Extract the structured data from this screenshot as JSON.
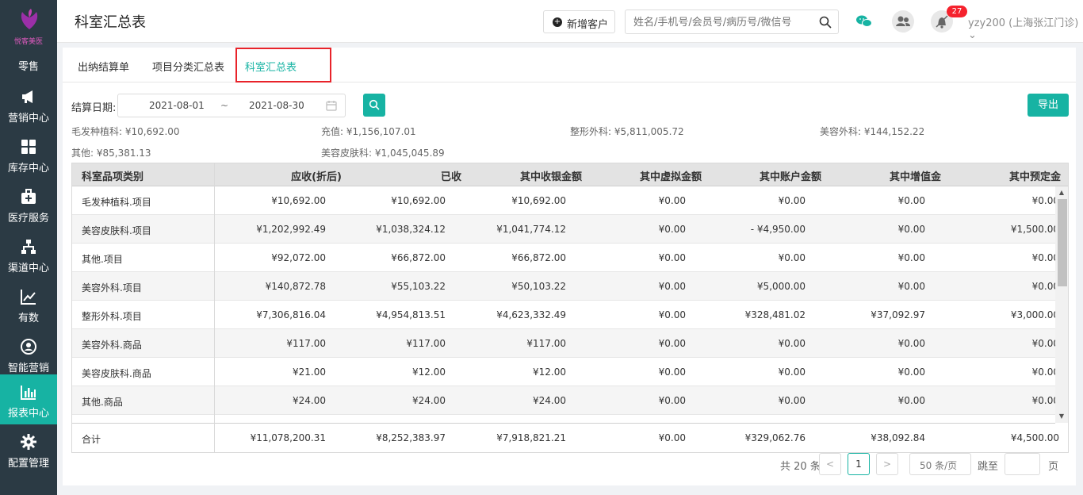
{
  "sidebar": {
    "logo_text": "悦客美医",
    "items": [
      {
        "label": "零售",
        "icon": "retail-icon"
      },
      {
        "label": "营销中心",
        "icon": "megaphone-icon"
      },
      {
        "label": "库存中心",
        "icon": "grid-icon"
      },
      {
        "label": "医疗服务",
        "icon": "medical-kit-icon"
      },
      {
        "label": "渠道中心",
        "icon": "org-chart-icon"
      },
      {
        "label": "有数",
        "icon": "trend-chart-icon"
      },
      {
        "label": "智能营销",
        "icon": "smart-marketing-icon"
      },
      {
        "label": "报表中心",
        "icon": "bar-chart-icon",
        "active": true
      },
      {
        "label": "配置管理",
        "icon": "gear-icon"
      }
    ]
  },
  "header": {
    "title": "科室汇总表",
    "new_customer": "新增客户",
    "search_placeholder": "姓名/手机号/会员号/病历号/微信号",
    "notification_count": "27",
    "user": "yzy200 (上海张江门诊) ⌄"
  },
  "tabs": [
    {
      "label": "出纳结算单"
    },
    {
      "label": "项目分类汇总表"
    },
    {
      "label": "科室汇总表",
      "active": true
    }
  ],
  "filter": {
    "label": "结算日期:",
    "start": "2021-08-01",
    "separator": "~",
    "end": "2021-08-30",
    "export": "导出"
  },
  "summary": [
    "毛发种植科: ¥10,692.00",
    "充值: ¥1,156,107.01",
    "整形外科: ¥5,811,005.72",
    "美容外科: ¥144,152.22",
    "其他: ¥85,381.13",
    "美容皮肤科: ¥1,045,045.89"
  ],
  "table": {
    "columns": [
      "科室品项类别",
      "应收(折后)",
      "已收",
      "其中收银金额",
      "其中虚拟金额",
      "其中账户金额",
      "其中增值金",
      "其中预定金"
    ],
    "rows": [
      [
        "毛发种植科.项目",
        "¥10,692.00",
        "¥10,692.00",
        "¥10,692.00",
        "¥0.00",
        "¥0.00",
        "¥0.00",
        "¥0.00"
      ],
      [
        "美容皮肤科.项目",
        "¥1,202,992.49",
        "¥1,038,324.12",
        "¥1,041,774.12",
        "¥0.00",
        "- ¥4,950.00",
        "¥0.00",
        "¥1,500.00"
      ],
      [
        "其他.项目",
        "¥92,072.00",
        "¥66,872.00",
        "¥66,872.00",
        "¥0.00",
        "¥0.00",
        "¥0.00",
        "¥0.00"
      ],
      [
        "美容外科.项目",
        "¥140,872.78",
        "¥55,103.22",
        "¥50,103.22",
        "¥0.00",
        "¥5,000.00",
        "¥0.00",
        "¥0.00"
      ],
      [
        "整形外科.项目",
        "¥7,306,816.04",
        "¥4,954,813.51",
        "¥4,623,332.49",
        "¥0.00",
        "¥328,481.02",
        "¥37,092.97",
        "¥3,000.00"
      ],
      [
        "美容外科.商品",
        "¥117.00",
        "¥117.00",
        "¥117.00",
        "¥0.00",
        "¥0.00",
        "¥0.00",
        "¥0.00"
      ],
      [
        "美容皮肤科.商品",
        "¥21.00",
        "¥12.00",
        "¥12.00",
        "¥0.00",
        "¥0.00",
        "¥0.00",
        "¥0.00"
      ],
      [
        "其他.商品",
        "¥24.00",
        "¥24.00",
        "¥24.00",
        "¥0.00",
        "¥0.00",
        "¥0.00",
        "¥0.00"
      ]
    ],
    "footer": [
      "合计",
      "¥11,078,200.31",
      "¥8,252,383.97",
      "¥7,918,821.21",
      "¥0.00",
      "¥329,062.76",
      "¥38,092.84",
      "¥4,500.00"
    ]
  },
  "pager": {
    "total": "共 20 条",
    "prev": "<",
    "current": "1",
    "next": ">",
    "page_size": "50 条/页",
    "jump": "跳至",
    "page_suffix": "页"
  },
  "colors": {
    "accent": "#17b3a3",
    "sidebar": "#2b3a44",
    "highlight": "#e8232a"
  }
}
